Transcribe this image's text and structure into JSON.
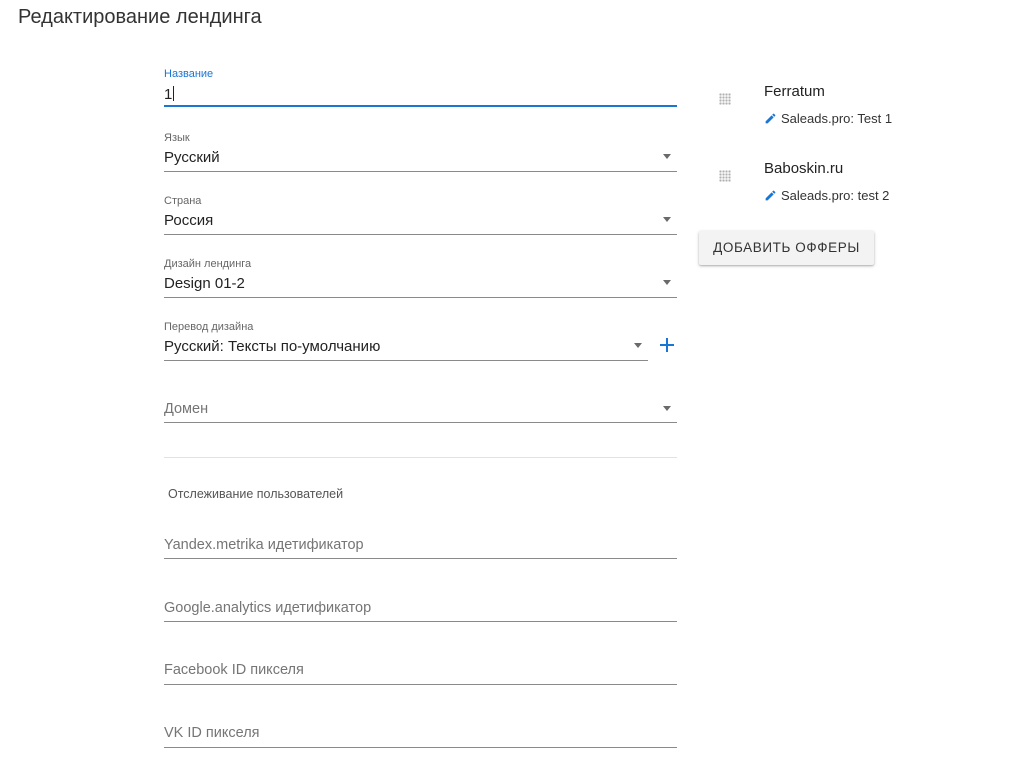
{
  "page": {
    "title": "Редактирование лендинга"
  },
  "form": {
    "name": {
      "label": "Название",
      "value": "1"
    },
    "language": {
      "label": "Язык",
      "value": "Русский"
    },
    "country": {
      "label": "Страна",
      "value": "Россия"
    },
    "design": {
      "label": "Дизайн лендинга",
      "value": "Design 01-2"
    },
    "design_translation": {
      "label": "Перевод дизайна",
      "value": "Русский: Тексты по-умолчанию"
    },
    "domain": {
      "placeholder": "Домен"
    }
  },
  "tracking": {
    "section_label": "Отслеживание пользователей",
    "yandex_metrika": {
      "placeholder": "Yandex.metrika идетификатор"
    },
    "google_analytics": {
      "placeholder": "Google.analytics идетификатор"
    },
    "facebook_pixel": {
      "placeholder": "Facebook ID пикселя"
    },
    "vk_pixel": {
      "placeholder": "VK ID пикселя"
    }
  },
  "offers": {
    "items": [
      {
        "name": "Ferratum",
        "subtitle": "Saleads.pro: Test 1"
      },
      {
        "name": "Baboskin.ru",
        "subtitle": "Saleads.pro: test 2"
      }
    ],
    "add_button_label": "ДОБАВИТЬ ОФФЕРЫ"
  },
  "colors": {
    "accent": "#1976d2",
    "underline": "#8a8a8a",
    "button_bg": "#f3f3f3"
  },
  "icons": {
    "dropdown": "arrow-drop-down-icon",
    "add": "plus-icon",
    "drag": "drag-handle-icon",
    "edit": "pencil-icon"
  }
}
